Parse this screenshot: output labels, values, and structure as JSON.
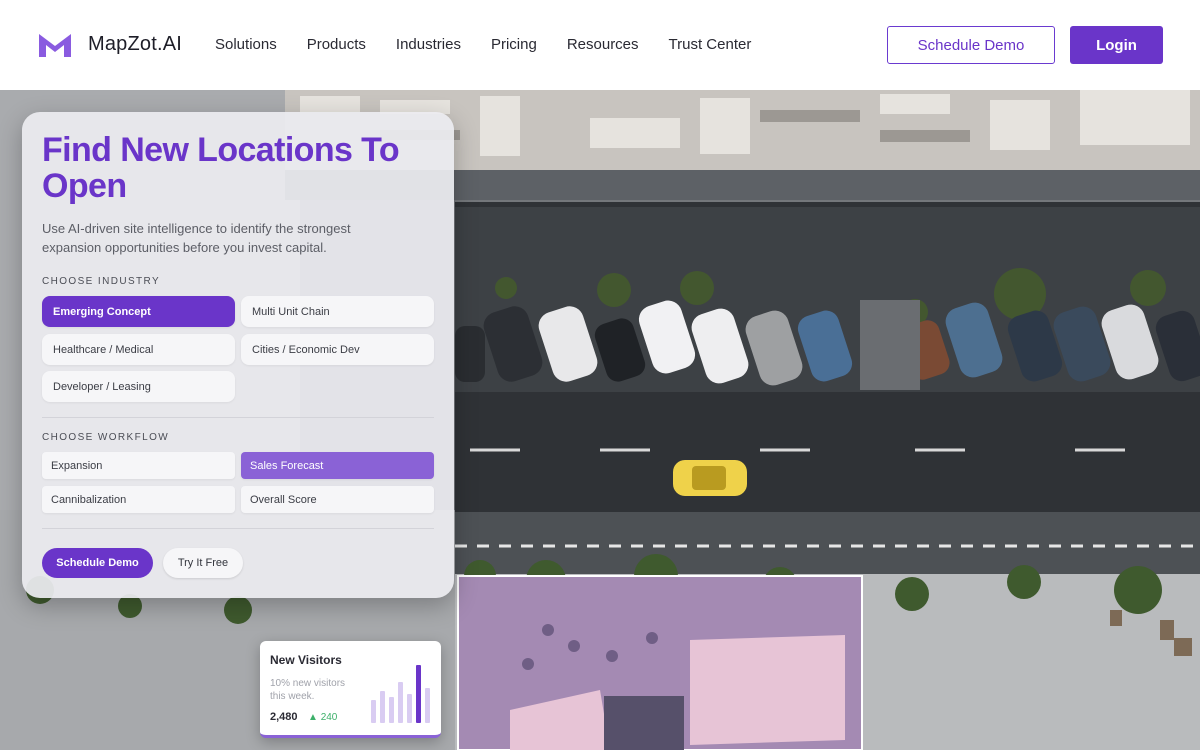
{
  "header": {
    "brand": "MapZot.AI",
    "nav": [
      "Solutions",
      "Products",
      "Industries",
      "Pricing",
      "Resources",
      "Trust Center"
    ],
    "schedule_demo": "Schedule Demo",
    "login": "Login"
  },
  "hero": {
    "title": "Find New Locations To Open",
    "subtitle": "Use AI-driven site intelligence to identify the strongest expansion opportunities before you invest capital.",
    "industry_label": "CHOOSE INDUSTRY",
    "industries": [
      {
        "label": "Emerging Concept",
        "selected": true
      },
      {
        "label": "Multi Unit Chain",
        "selected": false
      },
      {
        "label": "Healthcare / Medical",
        "selected": false
      },
      {
        "label": "Cities / Economic Dev",
        "selected": false
      },
      {
        "label": "Developer / Leasing",
        "selected": false
      }
    ],
    "workflow_label": "CHOOSE WORKFLOW",
    "workflows": [
      {
        "label": "Expansion",
        "selected": false
      },
      {
        "label": "Sales Forecast",
        "selected": true
      },
      {
        "label": "Cannibalization",
        "selected": false
      },
      {
        "label": "Overall Score",
        "selected": false
      }
    ],
    "cta_primary": "Schedule Demo",
    "cta_secondary": "Try It Free"
  },
  "visitors_widget": {
    "title": "New Visitors",
    "subtitle": "10% new visitors this week.",
    "count": "2,480",
    "delta": "240",
    "trend_up": true,
    "bars": [
      0.4,
      0.55,
      0.45,
      0.7,
      0.5,
      1.0,
      0.6
    ]
  },
  "colors": {
    "accent": "#6a35c9",
    "accent_light": "#8a62d6",
    "positive": "#3db06a"
  }
}
